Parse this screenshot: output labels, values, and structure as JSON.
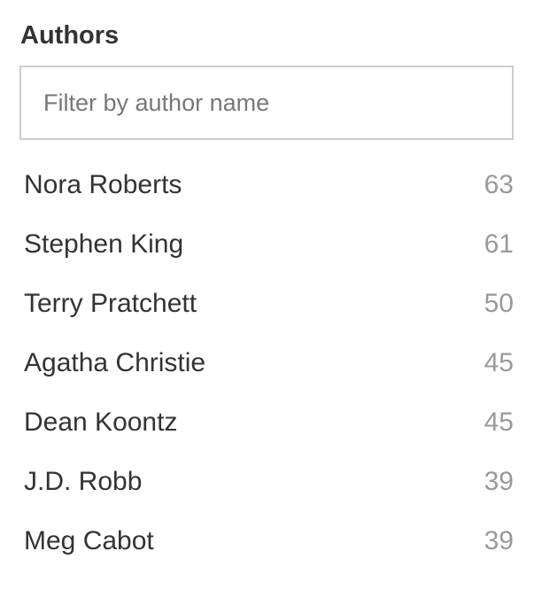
{
  "section": {
    "title": "Authors"
  },
  "filter": {
    "placeholder": "Filter by author name",
    "value": ""
  },
  "authors": [
    {
      "name": "Nora Roberts",
      "count": "63"
    },
    {
      "name": "Stephen King",
      "count": "61"
    },
    {
      "name": "Terry Pratchett",
      "count": "50"
    },
    {
      "name": "Agatha Christie",
      "count": "45"
    },
    {
      "name": "Dean Koontz",
      "count": "45"
    },
    {
      "name": "J.D. Robb",
      "count": "39"
    },
    {
      "name": "Meg Cabot",
      "count": "39"
    }
  ]
}
